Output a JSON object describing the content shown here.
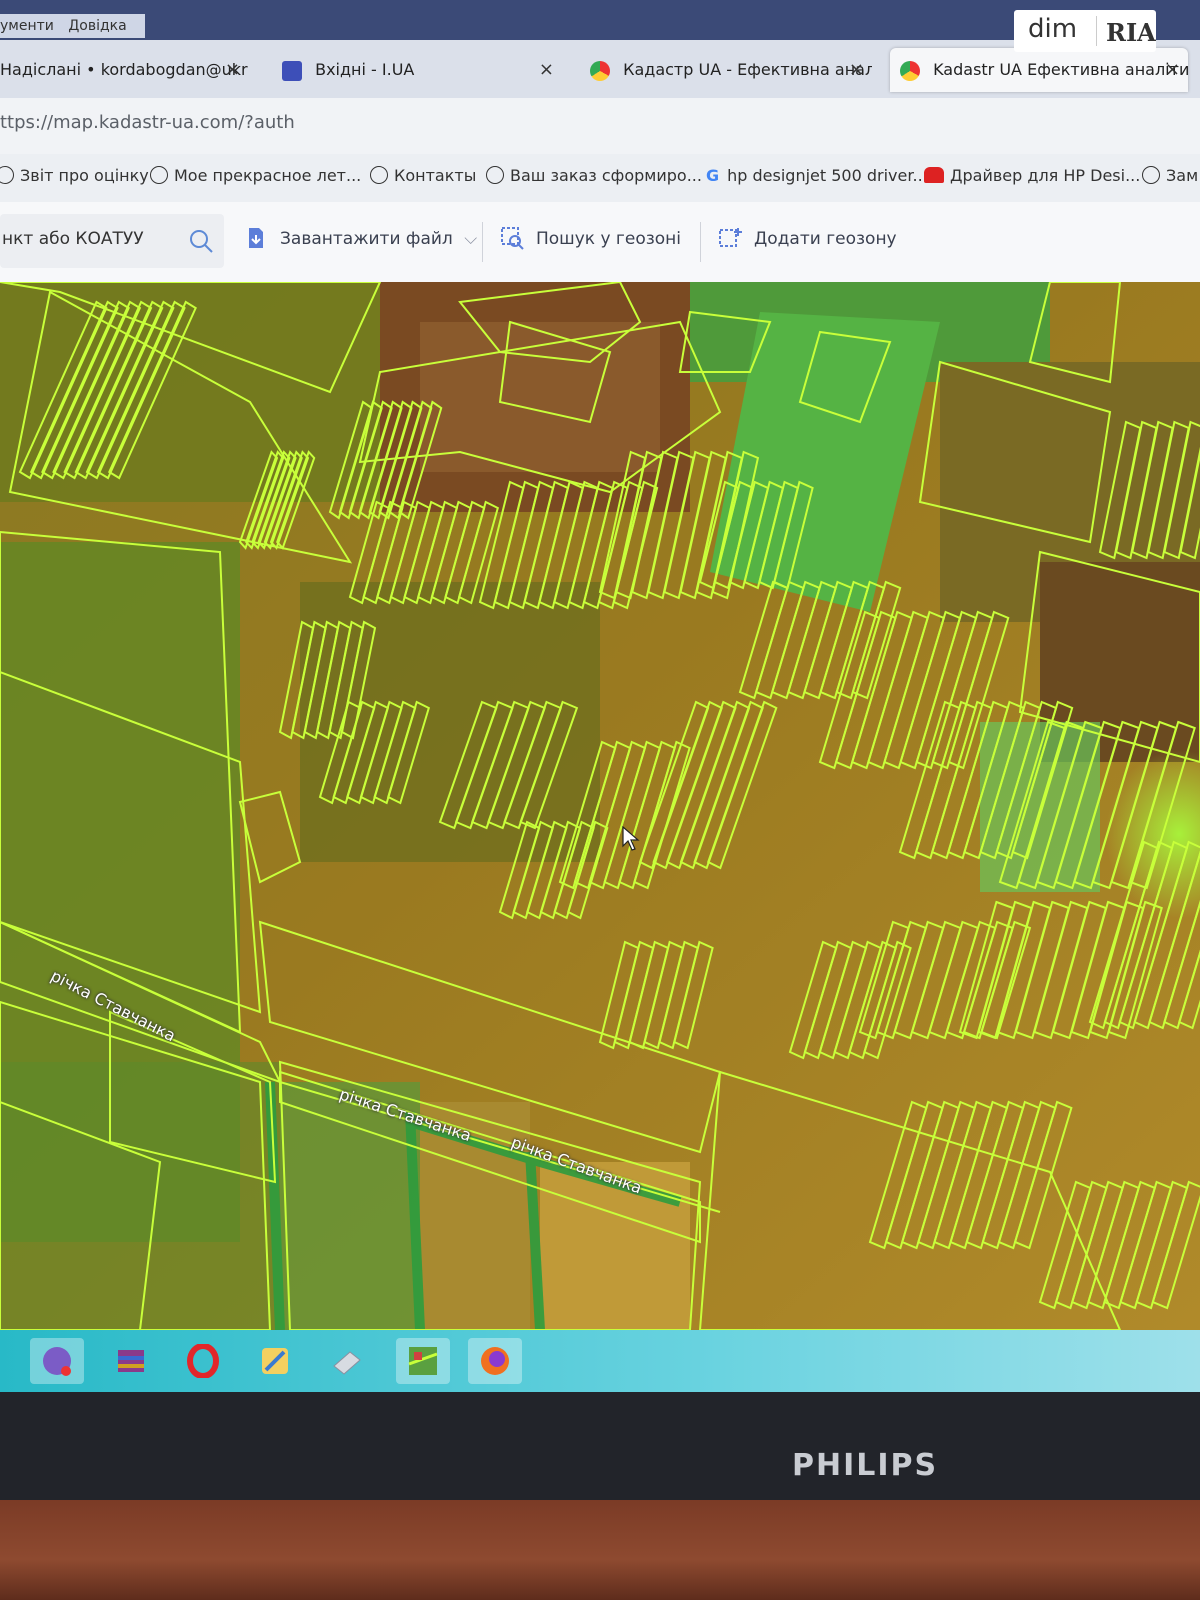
{
  "menubar": {
    "items": [
      "ументи",
      "Довідка"
    ]
  },
  "watermark": {
    "left": "dim",
    "right": "RIA"
  },
  "tabs": [
    {
      "label": "Надіслані • kordabogdan@ukr",
      "close": "×",
      "active": false
    },
    {
      "label": "Вхідні - I.UA",
      "close": "×",
      "active": false
    },
    {
      "label": "Кадастр UA - Ефективна анал",
      "close": "×",
      "active": false
    },
    {
      "label": "Kadastr UA Ефективна аналіти",
      "close": "×",
      "active": true
    }
  ],
  "address": {
    "url": "ttps://map.kadastr-ua.com/?auth"
  },
  "bookmarks": [
    {
      "label": "Звіт про оцінку",
      "icon": "globe-icon"
    },
    {
      "label": "Мое прекрасное лет...",
      "icon": "globe-icon"
    },
    {
      "label": "Контакты",
      "icon": "globe-icon"
    },
    {
      "label": "Ваш заказ сформиро...",
      "icon": "globe-icon"
    },
    {
      "label": "hp designjet 500 driver...",
      "icon": "google-icon"
    },
    {
      "label": "Драйвер для HP Desi...",
      "icon": "hp-icon"
    },
    {
      "label": "Зам",
      "icon": "globe-icon"
    }
  ],
  "apptools": {
    "search_value": "нкт або КОАТУУ",
    "upload_label": "Завантажити файл",
    "geosearch_label": "Пошук у геозоні",
    "addzone_label": "Додати геозону"
  },
  "map": {
    "river_labels": [
      "річка Ставчанка",
      "річка Ставчанка",
      "річка Ставчанка"
    ],
    "parcel_color": "#c8ff3a"
  },
  "taskbar": {
    "apps": [
      "viber-icon",
      "winrar-icon",
      "opera-icon",
      "paint-icon",
      "printer-icon",
      "map-app-icon",
      "firefox-icon"
    ]
  },
  "monitor": {
    "brand": "PHILIPS"
  }
}
